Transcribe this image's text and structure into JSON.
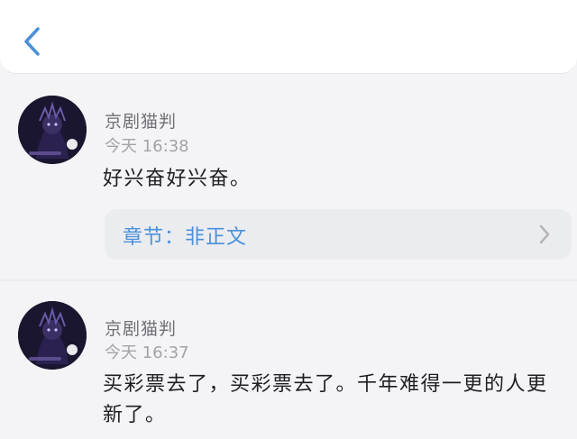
{
  "nav": {
    "back_icon": "chevron-left-icon",
    "accent": "#4a90d9"
  },
  "comments": [
    {
      "username": "京剧猫判",
      "time": "今天 16:38",
      "content": "好兴奋好兴奋。",
      "chapter_label": "章节：非正文"
    },
    {
      "username": "京剧猫判",
      "time": "今天 16:37",
      "content": "买彩票去了，买彩票去了。千年难得一更的人更新了。"
    }
  ]
}
